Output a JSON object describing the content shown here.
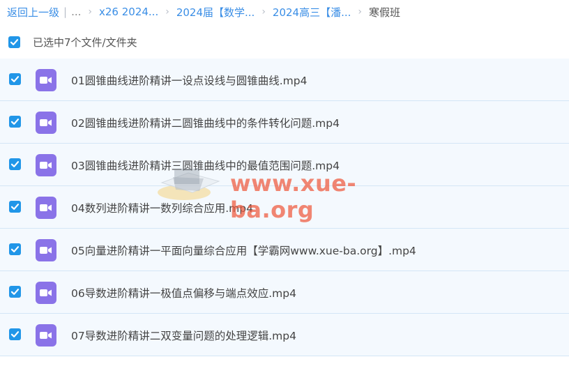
{
  "breadcrumb": {
    "back": "返回上一级",
    "separator": "|",
    "ellipsis": "...",
    "items": [
      "x26 2024...",
      "2024届【数学...",
      "2024高三【潘..."
    ],
    "current": "寒假班"
  },
  "selection": {
    "summary": "已选中7个文件/文件夹"
  },
  "files": [
    {
      "name": "01圆锥曲线进阶精讲一设点设线与圆锥曲线.mp4",
      "checked": true,
      "icon": "video-icon"
    },
    {
      "name": "02圆锥曲线进阶精讲二圆锥曲线中的条件转化问题.mp4",
      "checked": true,
      "icon": "video-icon"
    },
    {
      "name": "03圆锥曲线进阶精讲三圆锥曲线中的最值范围问题.mp4",
      "checked": true,
      "icon": "video-icon"
    },
    {
      "name": "04数列进阶精讲一数列综合应用.mp4",
      "checked": true,
      "icon": "video-icon"
    },
    {
      "name": "05向量进阶精讲一平面向量综合应用【学霸网www.xue-ba.org】.mp4",
      "checked": true,
      "icon": "video-icon"
    },
    {
      "name": "06导数进阶精讲一极值点偏移与端点效应.mp4",
      "checked": true,
      "icon": "video-icon"
    },
    {
      "name": "07导数进阶精讲二双变量问题的处理逻辑.mp4",
      "checked": true,
      "icon": "video-icon"
    }
  ],
  "watermark": {
    "text": "www.xue-ba.org"
  },
  "colors": {
    "link": "#3a8ee6",
    "checkbox": "#2196e8",
    "video_icon": "#8a73e8",
    "row_bg": "#f4f9fe",
    "row_border": "#d4e6f6",
    "watermark": "#ee583c"
  }
}
